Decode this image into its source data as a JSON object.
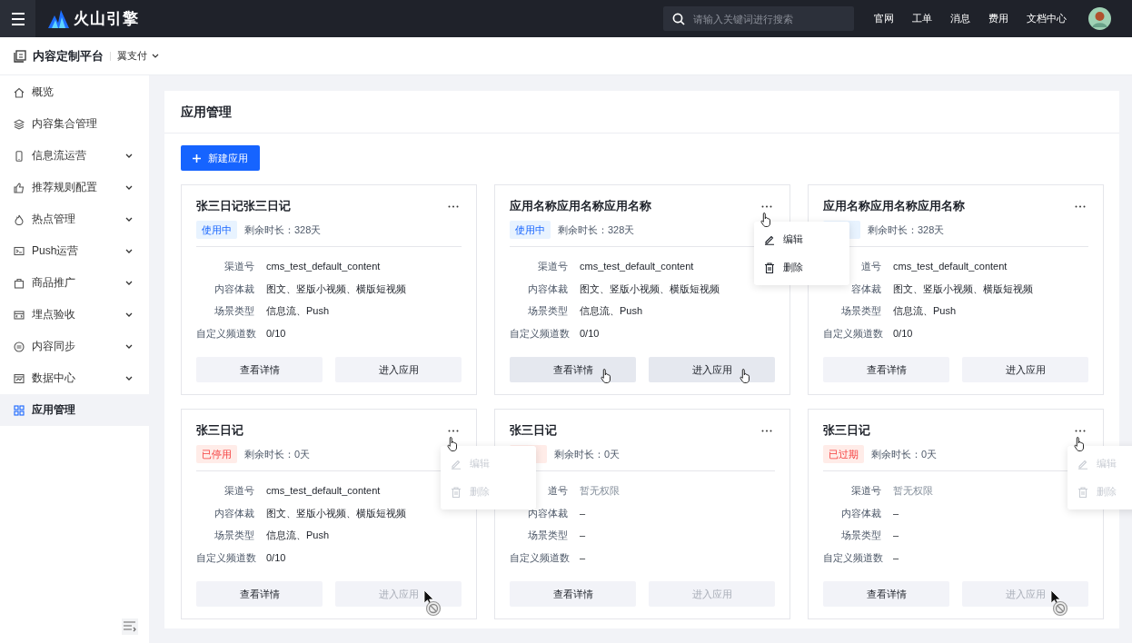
{
  "topbar": {
    "brand": "火山引擎",
    "search": {
      "placeholder": "请输入关键词进行搜索"
    },
    "links": [
      "官网",
      "工单",
      "消息",
      "费用",
      "文档中心"
    ]
  },
  "subheader": {
    "title": "内容定制平台",
    "account": "翼支付"
  },
  "sidebar": {
    "items": [
      {
        "label": "概览",
        "expandable": false,
        "selected": false
      },
      {
        "label": "内容集合管理",
        "expandable": false,
        "selected": false
      },
      {
        "label": "信息流运营",
        "expandable": true,
        "selected": false
      },
      {
        "label": "推荐规则配置",
        "expandable": true,
        "selected": false
      },
      {
        "label": "热点管理",
        "expandable": true,
        "selected": false
      },
      {
        "label": "Push运营",
        "expandable": true,
        "selected": false
      },
      {
        "label": "商品推广",
        "expandable": true,
        "selected": false
      },
      {
        "label": "埋点验收",
        "expandable": true,
        "selected": false
      },
      {
        "label": "内容同步",
        "expandable": true,
        "selected": false
      },
      {
        "label": "数据中心",
        "expandable": true,
        "selected": false
      },
      {
        "label": "应用管理",
        "expandable": false,
        "selected": true
      }
    ]
  },
  "page": {
    "title": "应用管理",
    "new_button": "新建应用"
  },
  "cards": [
    {
      "title": "张三日记张三日记",
      "status": {
        "kind": "active",
        "label": "使用中"
      },
      "remaining": "剩余时长：328天",
      "menu_open": false,
      "fields": [
        {
          "label": "渠道号",
          "value": "cms_test_default_content",
          "muted": false
        },
        {
          "label": "内容体裁",
          "value": "图文、竖版小视频、横版短视频",
          "muted": false
        },
        {
          "label": "场景类型",
          "value": "信息流、Push",
          "muted": false
        },
        {
          "label": "自定义频道数",
          "value": "0/10",
          "muted": false
        }
      ],
      "buttons": [
        {
          "label": "查看详情",
          "disabled": false,
          "hovered": false
        },
        {
          "label": "进入应用",
          "disabled": false,
          "hovered": false
        }
      ]
    },
    {
      "title": "应用名称应用名称应用名称",
      "status": {
        "kind": "active",
        "label": "使用中"
      },
      "remaining": "剩余时长：328天",
      "menu_open": true,
      "menu": [
        {
          "label": "编辑",
          "disabled": false
        },
        {
          "label": "删除",
          "disabled": false
        }
      ],
      "fields": [
        {
          "label": "渠道号",
          "value": "cms_test_default_content",
          "muted": false
        },
        {
          "label": "内容体裁",
          "value": "图文、竖版小视频、横版短视频",
          "muted": false
        },
        {
          "label": "场景类型",
          "value": "信息流、Push",
          "muted": false
        },
        {
          "label": "自定义频道数",
          "value": "0/10",
          "muted": false
        }
      ],
      "buttons": [
        {
          "label": "查看详情",
          "disabled": false,
          "hovered": true
        },
        {
          "label": "进入应用",
          "disabled": false,
          "hovered": true
        }
      ]
    },
    {
      "title": "应用名称应用名称应用名称",
      "status": {
        "kind": "active"
      },
      "remaining": "剩余时长：328天",
      "menu_open": false,
      "fields": [
        {
          "label": "道号",
          "value": "cms_test_default_content",
          "muted": false
        },
        {
          "label": "容体裁",
          "value": "图文、竖版小视频、横版短视频",
          "muted": false
        },
        {
          "label": "场景类型",
          "value": "信息流、Push",
          "muted": false
        },
        {
          "label": "自定义频道数",
          "value": "0/10",
          "muted": false
        }
      ],
      "buttons": [
        {
          "label": "查看详情",
          "disabled": false,
          "hovered": false
        },
        {
          "label": "进入应用",
          "disabled": false,
          "hovered": false
        }
      ]
    },
    {
      "title": "张三日记",
      "status": {
        "kind": "stopped",
        "label": "已停用"
      },
      "remaining": "剩余时长：0天",
      "menu_open": true,
      "menu": [
        {
          "label": "编辑",
          "disabled": true
        },
        {
          "label": "删除",
          "disabled": true
        }
      ],
      "fields": [
        {
          "label": "渠道号",
          "value": "cms_test_default_content",
          "muted": false
        },
        {
          "label": "内容体裁",
          "value": "图文、竖版小视频、横版短视频",
          "muted": false
        },
        {
          "label": "场景类型",
          "value": "信息流、Push",
          "muted": false
        },
        {
          "label": "自定义频道数",
          "value": "0/10",
          "muted": false
        }
      ],
      "buttons": [
        {
          "label": "查看详情",
          "disabled": false,
          "hovered": false
        },
        {
          "label": "进入应用",
          "disabled": true,
          "hovered": true
        }
      ]
    },
    {
      "title": "张三日记",
      "status": {
        "kind": "stopped"
      },
      "remaining": "剩余时长：0天",
      "menu_open": false,
      "fields": [
        {
          "label": "道号",
          "value": "暂无权限",
          "muted": true
        },
        {
          "label": "内容体裁",
          "value": "–",
          "muted": false
        },
        {
          "label": "场景类型",
          "value": "–",
          "muted": false
        },
        {
          "label": "自定义频道数",
          "value": "–",
          "muted": false
        }
      ],
      "buttons": [
        {
          "label": "查看详情",
          "disabled": false,
          "hovered": false
        },
        {
          "label": "进入应用",
          "disabled": true,
          "hovered": false
        }
      ]
    },
    {
      "title": "张三日记",
      "status": {
        "kind": "expired",
        "label": "已过期"
      },
      "remaining": "剩余时长：0天",
      "menu_open": true,
      "menu": [
        {
          "label": "编辑",
          "disabled": true
        },
        {
          "label": "删除",
          "disabled": true
        }
      ],
      "fields": [
        {
          "label": "渠道号",
          "value": "暂无权限",
          "muted": true
        },
        {
          "label": "内容体裁",
          "value": "–",
          "muted": false
        },
        {
          "label": "场景类型",
          "value": "–",
          "muted": false
        },
        {
          "label": "自定义频道数",
          "value": "–",
          "muted": false
        }
      ],
      "buttons": [
        {
          "label": "查看详情",
          "disabled": false,
          "hovered": false
        },
        {
          "label": "进入应用",
          "disabled": true,
          "hovered": true
        }
      ]
    }
  ]
}
